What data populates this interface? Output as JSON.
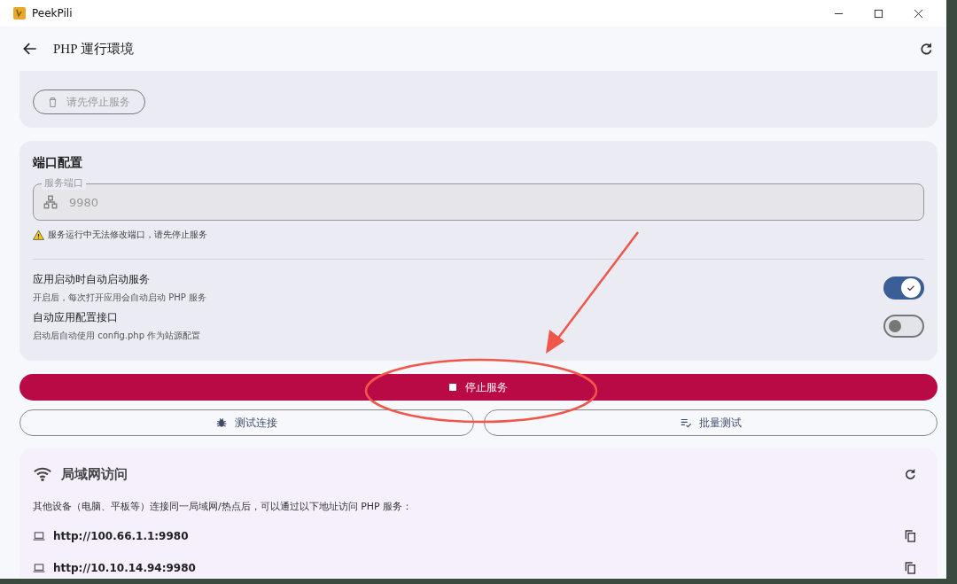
{
  "window": {
    "title": "PeekPili"
  },
  "header": {
    "title": "PHP 運行環境"
  },
  "extensions_card": {
    "button": {
      "label": "请先停止服务",
      "disabled": true
    }
  },
  "port_card": {
    "title": "端口配置",
    "field": {
      "label": "服务端口",
      "value": "9980",
      "disabled": true
    },
    "warning": "服务运行中无法修改端口，请先停止服务"
  },
  "settings": [
    {
      "title": "应用启动时自动启动服务",
      "subtitle": "开启后，每次打开应用会自动启动 PHP 服务",
      "on": true
    },
    {
      "title": "自动应用配置接口",
      "subtitle": "启动后自动使用 config.php 作为站源配置",
      "on": false
    }
  ],
  "stop_button": {
    "label": "停止服务"
  },
  "test_buttons": [
    {
      "label": "测试连接",
      "kind": "bug"
    },
    {
      "label": "批量测试",
      "kind": "list"
    }
  ],
  "lan_card": {
    "title": "局域网访问",
    "description": "其他设备（电脑、平板等）连接同一局域网/热点后，可以通过以下地址访问 PHP 服务：",
    "urls": [
      "http://100.66.1.1:9980",
      "http://10.10.14.94:9980"
    ]
  }
}
